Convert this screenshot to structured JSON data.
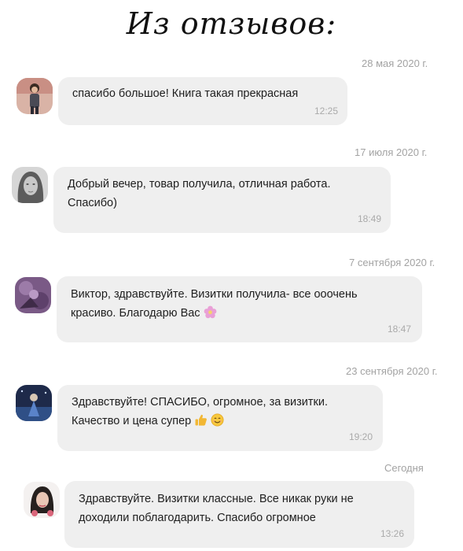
{
  "header": {
    "title": "Из отзывов:"
  },
  "reviews": [
    {
      "date": "28 мая 2020 г.",
      "lines": [
        "спасибо большое! Книга такая прекрасная"
      ],
      "time": "12:25",
      "avatar": "user-photo-girl-red-background"
    },
    {
      "date": "17 июля 2020 г.",
      "lines": [
        "Добрый вечер, товар получила, отличная работа.",
        "Спасибо)"
      ],
      "time": "18:49",
      "avatar": "user-photo-grayscale-woman"
    },
    {
      "date": "7 сентября 2020 г.",
      "lines": [
        "Виктор, здравствуйте. Визитки получила- все ооочень",
        "красиво. Благодарю Вас"
      ],
      "time": "18:47",
      "avatar": "user-photo-purple-flowers",
      "emojis": [
        "flower-emoji"
      ]
    },
    {
      "date": "23 сентября 2020 г.",
      "lines": [
        "Здравствуйте! СПАСИБО, огромное, за визитки.",
        "Качество и цена супер"
      ],
      "time": "19:20",
      "avatar": "user-photo-blue-night",
      "emojis": [
        "thumbs-up-emoji",
        "smiling-face-emoji"
      ]
    },
    {
      "date": "Сегодня",
      "lines": [
        "Здравствуйте.  Визитки классные. Все никак руки не",
        "доходили поблагодарить. Спасибо огромное"
      ],
      "time": "13:26",
      "avatar": "user-photo-dark-haired-woman"
    }
  ],
  "colors": {
    "bubble": "#efefef",
    "date_text": "#a3a3a3",
    "time_text": "#aaaaaa"
  }
}
